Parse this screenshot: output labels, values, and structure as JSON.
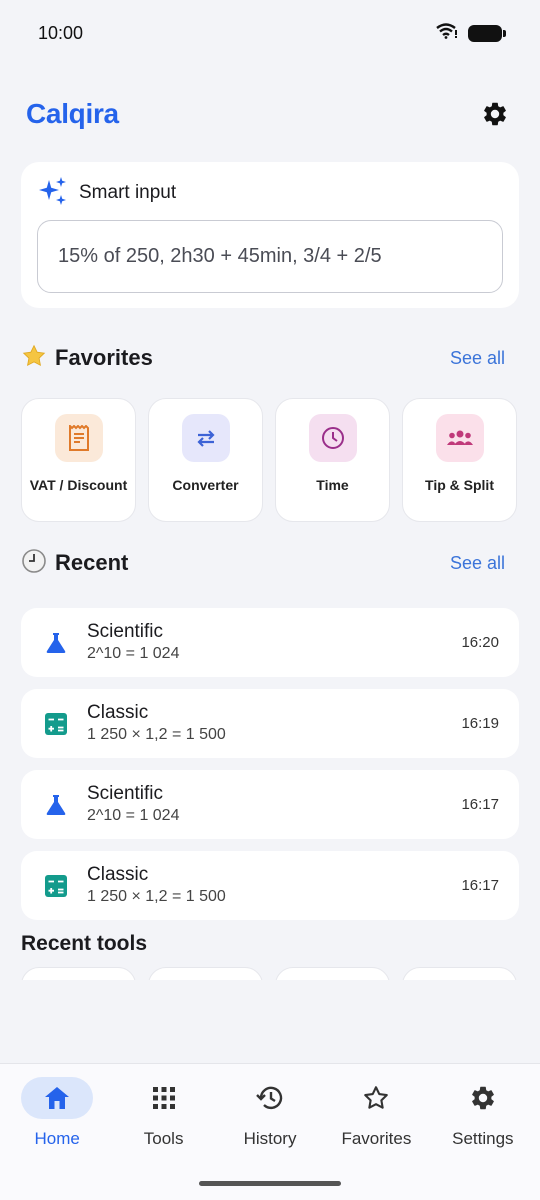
{
  "status": {
    "time": "10:00"
  },
  "app": {
    "title": "Calqira"
  },
  "smart_input": {
    "label": "Smart input",
    "placeholder": "15% of 250, 2h30 + 45min, 3/4 + 2/5"
  },
  "favorites": {
    "title": "Favorites",
    "see_all": "See all",
    "items": [
      {
        "label": "VAT / Discount",
        "icon": "receipt-icon",
        "bg": "#fbe9d9",
        "color": "#e07a2a"
      },
      {
        "label": "Converter",
        "icon": "swap-arrows-icon",
        "bg": "#e6e7fb",
        "color": "#3d63d6"
      },
      {
        "label": "Time",
        "icon": "clock-icon",
        "bg": "#f5dff0",
        "color": "#9a2f8a"
      },
      {
        "label": "Tip & Split",
        "icon": "group-icon",
        "bg": "#fbe0ea",
        "color": "#c0397a"
      }
    ]
  },
  "recent": {
    "title": "Recent",
    "see_all": "See all",
    "items": [
      {
        "title": "Scientific",
        "expr": "2^10 = 1 024",
        "time": "16:20",
        "icon": "flask-icon"
      },
      {
        "title": "Classic",
        "expr": "1 250 × 1,2 = 1 500",
        "time": "16:19",
        "icon": "calculator-icon"
      },
      {
        "title": "Scientific",
        "expr": "2^10 = 1 024",
        "time": "16:17",
        "icon": "flask-icon"
      },
      {
        "title": "Classic",
        "expr": "1 250 × 1,2 = 1 500",
        "time": "16:17",
        "icon": "calculator-icon"
      }
    ]
  },
  "recent_tools": {
    "title": "Recent tools"
  },
  "nav": {
    "items": [
      {
        "label": "Home",
        "icon": "home-icon",
        "active": true
      },
      {
        "label": "Tools",
        "icon": "grid-icon",
        "active": false
      },
      {
        "label": "History",
        "icon": "history-icon",
        "active": false
      },
      {
        "label": "Favorites",
        "icon": "star-outline-icon",
        "active": false
      },
      {
        "label": "Settings",
        "icon": "gear-icon",
        "active": false
      }
    ]
  },
  "colors": {
    "accent": "#2563eb",
    "background": "#f3f4f8",
    "flask": "#2563eb",
    "calculator": "#139b8c"
  }
}
